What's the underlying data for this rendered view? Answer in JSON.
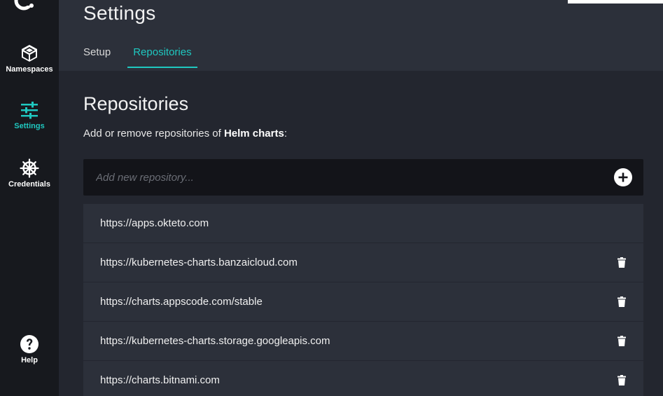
{
  "sidebar": {
    "logo_icon": "okteto-logo-icon",
    "items": [
      {
        "label": "Namespaces",
        "icon": "cube-icon",
        "active": false
      },
      {
        "label": "Settings",
        "icon": "sliders-icon",
        "active": true
      },
      {
        "label": "Credentials",
        "icon": "helm-wheel-icon",
        "active": false
      }
    ],
    "help": {
      "label": "Help",
      "icon": "help-circle-icon"
    }
  },
  "header": {
    "title": "Settings",
    "tabs": [
      {
        "label": "Setup",
        "active": false
      },
      {
        "label": "Repositories",
        "active": true
      }
    ]
  },
  "main": {
    "section_title": "Repositories",
    "description_prefix": "Add or remove repositories of ",
    "description_bold": "Helm charts",
    "description_suffix": ":",
    "add_input": {
      "placeholder": "Add new repository...",
      "value": ""
    },
    "add_button_icon": "plus-circle-icon",
    "repositories": [
      {
        "url": "https://apps.okteto.com",
        "deletable": false
      },
      {
        "url": "https://kubernetes-charts.banzaicloud.com",
        "deletable": true
      },
      {
        "url": "https://charts.appscode.com/stable",
        "deletable": true
      },
      {
        "url": "https://kubernetes-charts.storage.googleapis.com",
        "deletable": true
      },
      {
        "url": "https://charts.bitnami.com",
        "deletable": true
      }
    ]
  },
  "colors": {
    "accent": "#1fc8c0",
    "sidebar_bg": "#17191e",
    "header_bg": "#2c303a",
    "page_bg": "#23262f",
    "input_bg": "#131419"
  }
}
